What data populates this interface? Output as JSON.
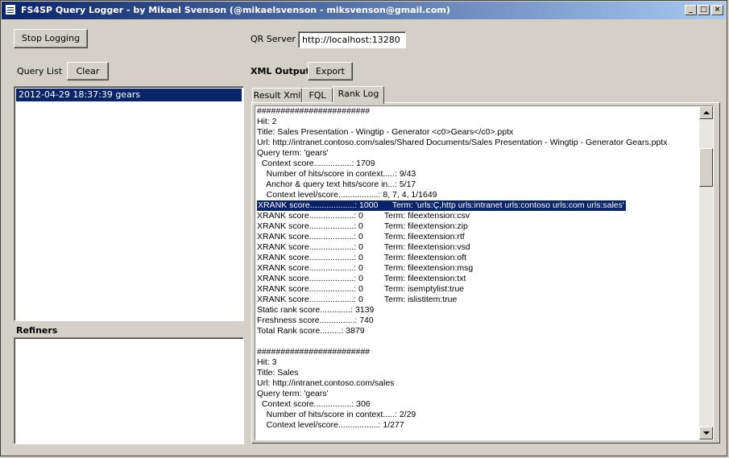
{
  "window": {
    "title": "FS4SP Query Logger - by Mikael Svenson (@mikaelsvenson - miksvenson@gmail.com)",
    "minimize": "_",
    "maximize": "□",
    "close": "×"
  },
  "toolbar": {
    "stop_logging_label": "Stop Logging",
    "qr_server_label": "QR Server",
    "qr_server_value": "http://localhost:13280"
  },
  "query_list": {
    "label": "Query List",
    "clear_label": "Clear",
    "items": [
      "2012-04-29 18:37:39 gears"
    ]
  },
  "xml_output": {
    "label": "XML Output",
    "export_label": "Export"
  },
  "refiners": {
    "label": "Refiners"
  },
  "tabs": [
    {
      "label": "Result Xml"
    },
    {
      "label": "FQL"
    },
    {
      "label": "Rank Log"
    }
  ],
  "active_tab": "Rank Log",
  "rank_log": {
    "lines": [
      "########################",
      "Hit: 2",
      "Title: Sales Presentation - Wingtip - Generator <c0>Gears</c0>.pptx",
      "Url: http://intranet.contoso.com/sales/Shared Documents/Sales Presentation - Wingtip - Generator Gears.pptx",
      "Query term: 'gears'",
      "  Context score................: 1709",
      "    Number of hits/score in context.....: 9/43",
      "    Anchor & query text hits/score in...: 5/17",
      "    Context level/score.................: 8, 7, 4, 1/1649",
      "XRANK score...................: 1000      Term: 'urls:Ç,http urls:intranet urls:contoso urls:com urls:sales'",
      "XRANK score...................: 0         Term: fileextension:csv",
      "XRANK score...................: 0         Term: fileextension:zip",
      "XRANK score...................: 0         Term: fileextension:rtf",
      "XRANK score...................: 0         Term: fileextension:vsd",
      "XRANK score...................: 0         Term: fileextension:oft",
      "XRANK score...................: 0         Term: fileextension:msg",
      "XRANK score...................: 0         Term: fileextension:txt",
      "XRANK score...................: 0         Term: isemptylist:true",
      "XRANK score...................: 0         Term: islistitem:true",
      "Static rank score.............: 3139",
      "Freshness score...............: 740",
      "Total Rank score.........: 3879",
      "",
      "########################",
      "Hit: 3",
      "Title: Sales",
      "Url: http://intranet.contoso.com/sales",
      "Query term: 'gears'",
      "  Context score................: 306",
      "    Number of hits/score in context.....: 2/29",
      "    Context level/score.................: 1/277"
    ]
  }
}
